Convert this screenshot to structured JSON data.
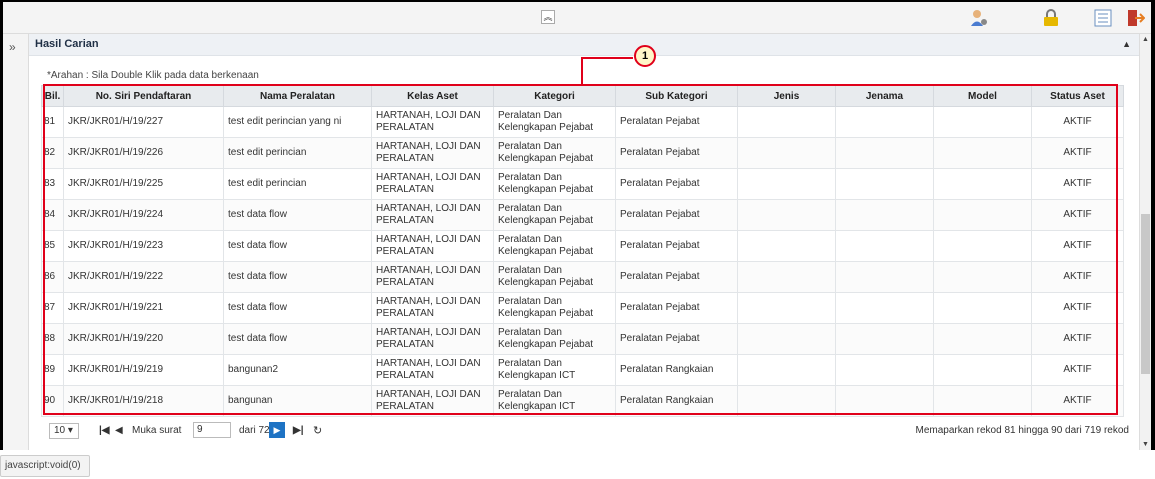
{
  "toolbar": {
    "collapse_glyph": "︽",
    "icons": [
      "user-settings-icon",
      "lock-icon",
      "list-view-icon",
      "logout-icon"
    ]
  },
  "panel": {
    "title": "Hasil Carian",
    "instruction": "*Arahan : Sila Double Klik pada data berkenaan",
    "callout_number": "1"
  },
  "grid": {
    "columns": [
      "Bil.",
      "No. Siri Pendaftaran",
      "Nama Peralatan",
      "Kelas Aset",
      "Kategori",
      "Sub Kategori",
      "Jenis",
      "Jenama",
      "Model",
      "Status Aset"
    ],
    "rows": [
      {
        "bil": "81",
        "no_siri": "JKR/JKR01/H/19/227",
        "nama": "test edit perincian yang ni",
        "kelas": "HARTANAH, LOJI DAN PERALATAN",
        "kategori": "Peralatan Dan Kelengkapan Pejabat",
        "sub": "Peralatan Pejabat",
        "jenis": "",
        "jenama": "",
        "model": "",
        "status": "AKTIF"
      },
      {
        "bil": "82",
        "no_siri": "JKR/JKR01/H/19/226",
        "nama": "test edit perincian",
        "kelas": "HARTANAH, LOJI DAN PERALATAN",
        "kategori": "Peralatan Dan Kelengkapan Pejabat",
        "sub": "Peralatan Pejabat",
        "jenis": "",
        "jenama": "",
        "model": "",
        "status": "AKTIF"
      },
      {
        "bil": "83",
        "no_siri": "JKR/JKR01/H/19/225",
        "nama": "test edit perincian",
        "kelas": "HARTANAH, LOJI DAN PERALATAN",
        "kategori": "Peralatan Dan Kelengkapan Pejabat",
        "sub": "Peralatan Pejabat",
        "jenis": "",
        "jenama": "",
        "model": "",
        "status": "AKTIF"
      },
      {
        "bil": "84",
        "no_siri": "JKR/JKR01/H/19/224",
        "nama": "test data flow",
        "kelas": "HARTANAH, LOJI DAN PERALATAN",
        "kategori": "Peralatan Dan Kelengkapan Pejabat",
        "sub": "Peralatan Pejabat",
        "jenis": "",
        "jenama": "",
        "model": "",
        "status": "AKTIF"
      },
      {
        "bil": "85",
        "no_siri": "JKR/JKR01/H/19/223",
        "nama": "test data flow",
        "kelas": "HARTANAH, LOJI DAN PERALATAN",
        "kategori": "Peralatan Dan Kelengkapan Pejabat",
        "sub": "Peralatan Pejabat",
        "jenis": "",
        "jenama": "",
        "model": "",
        "status": "AKTIF"
      },
      {
        "bil": "86",
        "no_siri": "JKR/JKR01/H/19/222",
        "nama": "test data flow",
        "kelas": "HARTANAH, LOJI DAN PERALATAN",
        "kategori": "Peralatan Dan Kelengkapan Pejabat",
        "sub": "Peralatan Pejabat",
        "jenis": "",
        "jenama": "",
        "model": "",
        "status": "AKTIF"
      },
      {
        "bil": "87",
        "no_siri": "JKR/JKR01/H/19/221",
        "nama": "test data flow",
        "kelas": "HARTANAH, LOJI DAN PERALATAN",
        "kategori": "Peralatan Dan Kelengkapan Pejabat",
        "sub": "Peralatan Pejabat",
        "jenis": "",
        "jenama": "",
        "model": "",
        "status": "AKTIF"
      },
      {
        "bil": "88",
        "no_siri": "JKR/JKR01/H/19/220",
        "nama": "test data flow",
        "kelas": "HARTANAH, LOJI DAN PERALATAN",
        "kategori": "Peralatan Dan Kelengkapan Pejabat",
        "sub": "Peralatan Pejabat",
        "jenis": "",
        "jenama": "",
        "model": "",
        "status": "AKTIF"
      },
      {
        "bil": "89",
        "no_siri": "JKR/JKR01/H/19/219",
        "nama": "bangunan2",
        "kelas": "HARTANAH, LOJI DAN PERALATAN",
        "kategori": "Peralatan Dan Kelengkapan ICT",
        "sub": "Peralatan Rangkaian",
        "jenis": "",
        "jenama": "",
        "model": "",
        "status": "AKTIF"
      },
      {
        "bil": "90",
        "no_siri": "JKR/JKR01/H/19/218",
        "nama": "bangunan",
        "kelas": "HARTANAH, LOJI DAN PERALATAN",
        "kategori": "Peralatan Dan Kelengkapan ICT",
        "sub": "Peralatan Rangkaian",
        "jenis": "",
        "jenama": "",
        "model": "",
        "status": "AKTIF"
      }
    ]
  },
  "pager": {
    "page_size": "10 ▾",
    "page_label": "Muka surat",
    "page_value": "9",
    "of_label": "dari 72",
    "info": "Memaparkan rekod 81 hingga 90 dari 719 rekod"
  },
  "statusbar": {
    "text": "javascript:void(0)"
  },
  "colors": {
    "highlight": "#e0001a",
    "pager_active": "#1e73c4"
  }
}
